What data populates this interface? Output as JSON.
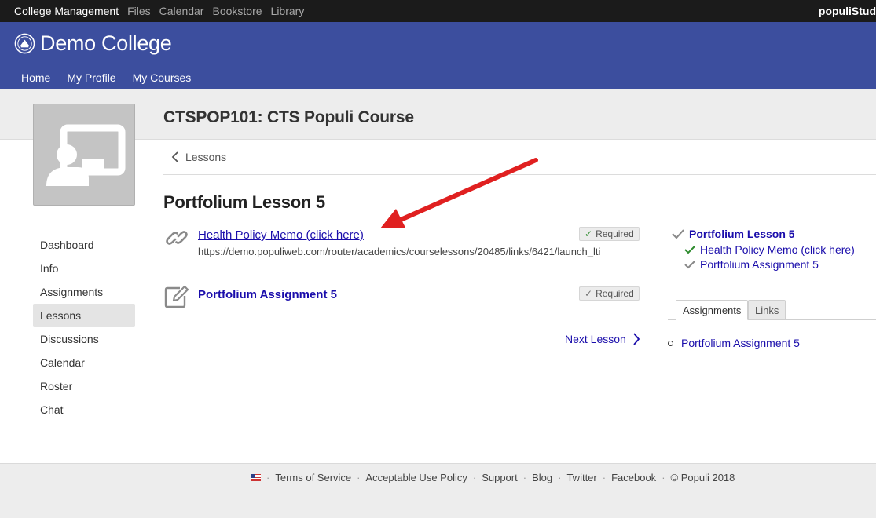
{
  "topbar": {
    "items": [
      "College Management",
      "Files",
      "Calendar",
      "Bookstore",
      "Library"
    ],
    "user": "populiStud"
  },
  "brand": {
    "name": "Demo College",
    "links": [
      "Home",
      "My Profile",
      "My Courses"
    ]
  },
  "course": {
    "title": "CTSPOP101: CTS Populi Course"
  },
  "sidenav": {
    "items": [
      "Dashboard",
      "Info",
      "Assignments",
      "Lessons",
      "Discussions",
      "Calendar",
      "Roster",
      "Chat"
    ],
    "active": "Lessons"
  },
  "main": {
    "back_label": "Lessons",
    "lesson_title": "Portfolium Lesson 5",
    "items": [
      {
        "title": "Health Policy Memo (click here)",
        "url": "https://demo.populiweb.com/router/academics/courselessons/20485/links/6421/launch_lti",
        "badge": "Required",
        "icon": "link-icon"
      },
      {
        "title": "Portfolium Assignment 5",
        "badge": "Required",
        "icon": "edit-icon"
      }
    ],
    "next_label": "Next Lesson"
  },
  "progress": {
    "lesson": "Portfolium Lesson 5",
    "items": [
      "Health Policy Memo (click here)",
      "Portfolium Assignment 5"
    ]
  },
  "tabs": {
    "items": [
      "Assignments",
      "Links"
    ],
    "active": "Assignments",
    "list": [
      "Portfolium Assignment 5"
    ]
  },
  "footer": {
    "links": [
      "Terms of Service",
      "Acceptable Use Policy",
      "Support",
      "Blog",
      "Twitter",
      "Facebook",
      "© Populi 2018"
    ]
  },
  "colors": {
    "topbar": "#1b1b1b",
    "brand": "#3c4e9e",
    "link": "#1a0dab",
    "annotation_arrow": "#e02020"
  }
}
